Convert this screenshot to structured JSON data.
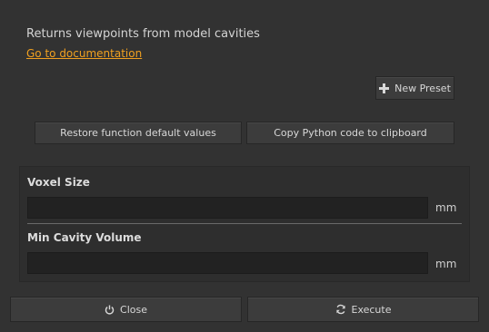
{
  "header": {
    "description": "Returns viewpoints from model cavities",
    "doc_link": "Go to documentation"
  },
  "presets": {
    "new_preset_label": "New Preset",
    "icon": "plus-icon"
  },
  "actions": {
    "restore_label": "Restore function default values",
    "copy_label": "Copy Python code to clipboard"
  },
  "params": {
    "voxel_size": {
      "label": "Voxel Size",
      "value": "",
      "unit": "mm"
    },
    "min_cavity_volume": {
      "label": "Min Cavity Volume",
      "value": "",
      "unit": "mm"
    }
  },
  "footer": {
    "close_label": "Close",
    "close_icon": "power-icon",
    "execute_label": "Execute",
    "execute_icon": "refresh-icon"
  },
  "colors": {
    "background": "#323232",
    "link": "#f0a020",
    "field": "#222222"
  }
}
